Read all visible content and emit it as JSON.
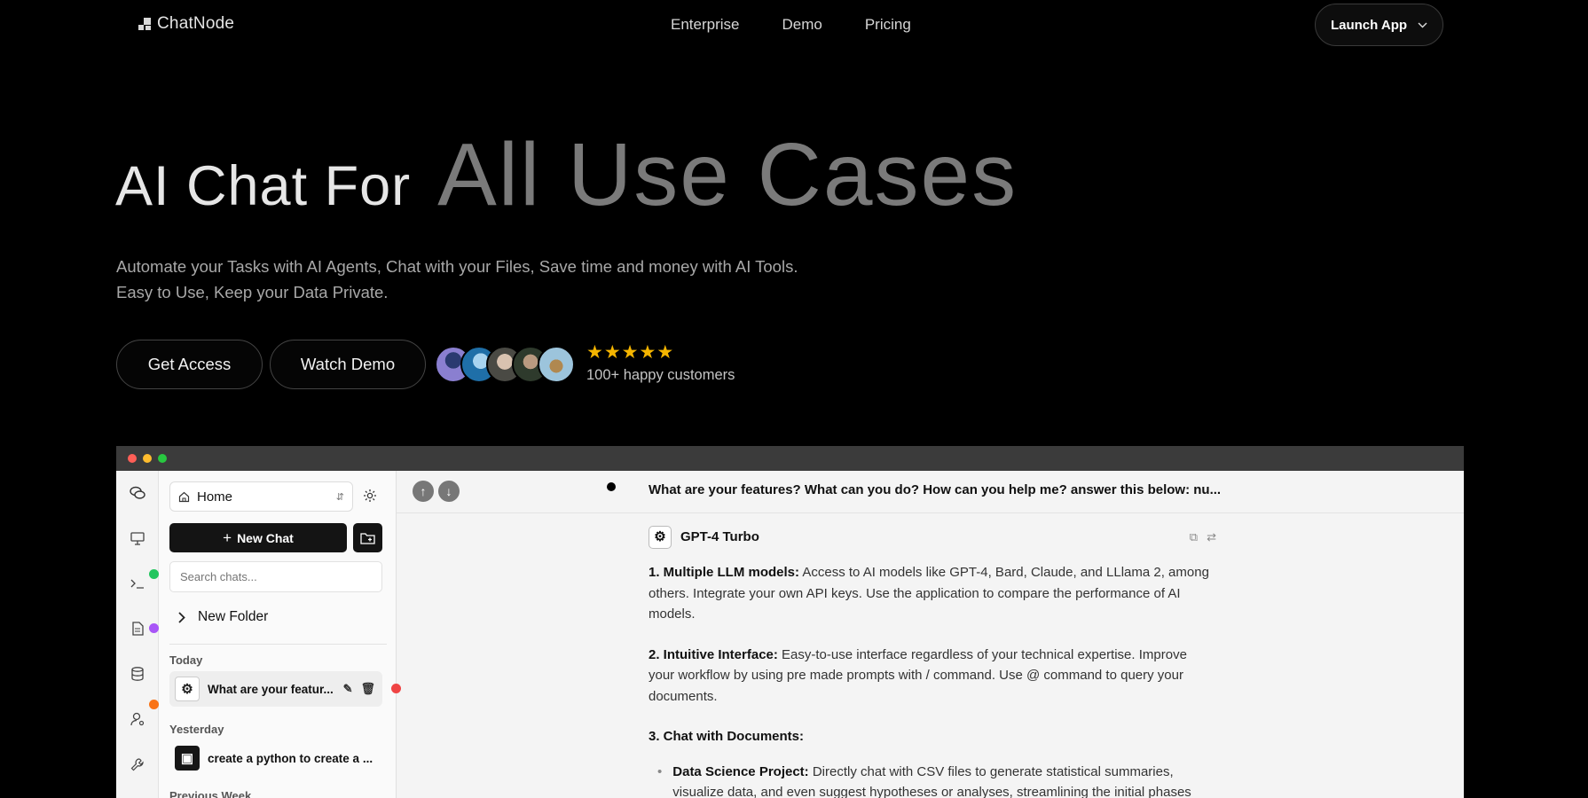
{
  "nav": {
    "logo_text": "ChatNode",
    "links": [
      "Enterprise",
      "Demo",
      "Pricing"
    ],
    "launch_label": "Launch App"
  },
  "hero": {
    "title_part1": "AI Chat For",
    "title_part2": "All Use Cases",
    "subtitle_line1": "Automate your Tasks with AI Agents, Chat with your Files, Save time and money with AI Tools.",
    "subtitle_line2": "Easy to Use, Keep your Data Private.",
    "cta_access": "Get Access",
    "cta_demo": "Watch Demo",
    "rating_stars": 5,
    "customers_text": "100+ happy customers"
  },
  "colors": {
    "star": "#f5b500",
    "window_close": "#ff5f57",
    "window_min": "#febc2e",
    "window_max": "#28c840"
  },
  "app": {
    "sidebar": {
      "home_label": "Home",
      "new_chat_label": "New Chat",
      "search_placeholder": "Search chats...",
      "folder_label": "New Folder",
      "group_today": "Today",
      "group_yesterday": "Yesterday",
      "group_prev": "Previous Week",
      "today_item": "What are your featur...",
      "yesterday_item": "create a python to create a ..."
    },
    "question": "What are your features? What can you do? How can you help me? answer this below: nu...",
    "model_name": "GPT-4 Turbo",
    "answer": {
      "p1_title": "1. Multiple LLM models:",
      "p1_text": " Access to AI models like GPT-4, Bard, Claude, and LLlama 2, among others. Integrate your own API keys. Use the application to compare the performance of AI models.",
      "p2_title": "2. Intuitive Interface:",
      "p2_text": " Easy-to-use interface regardless of your technical expertise. Improve your workflow by using pre made prompts with / command. Use @ command to query your documents.",
      "p3_title": "3. Chat with Documents:",
      "b1_title": "Data Science Project:",
      "b1_text": " Directly chat with CSV files to generate statistical summaries, visualize data, and even suggest hypotheses or analyses, streamlining the initial phases"
    }
  }
}
